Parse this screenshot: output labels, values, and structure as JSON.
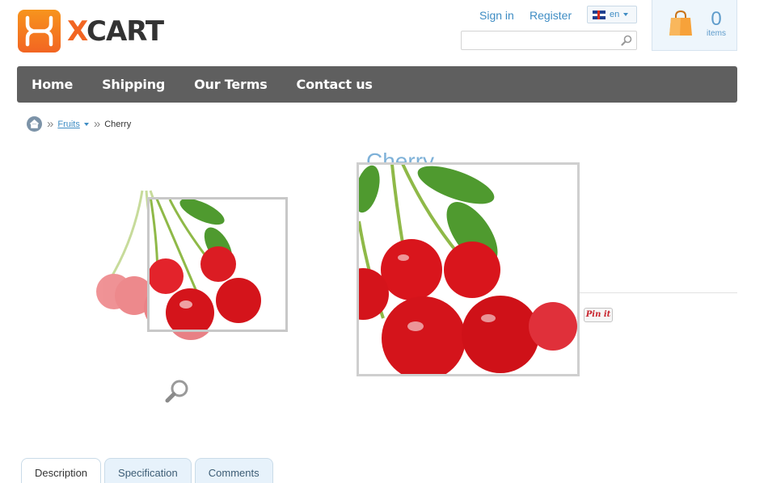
{
  "header": {
    "logo_x": "X",
    "logo_cart": "CART",
    "sign_in": "Sign in",
    "register": "Register",
    "language": "en",
    "search_placeholder": "",
    "cart_count": "0",
    "cart_label": "items"
  },
  "nav": {
    "items": [
      "Home",
      "Shipping",
      "Our Terms",
      "Contact us"
    ]
  },
  "breadcrumb": {
    "category": "Fruits",
    "current": "Cherry"
  },
  "product": {
    "title": "Cherry",
    "pinit": "Pin it"
  },
  "tabs": [
    "Description",
    "Specification",
    "Comments"
  ],
  "colors": {
    "accent": "#3f8dc4",
    "brand": "#f26522",
    "nav_bg": "#5f5f5f",
    "cherry": "#d7141a"
  }
}
